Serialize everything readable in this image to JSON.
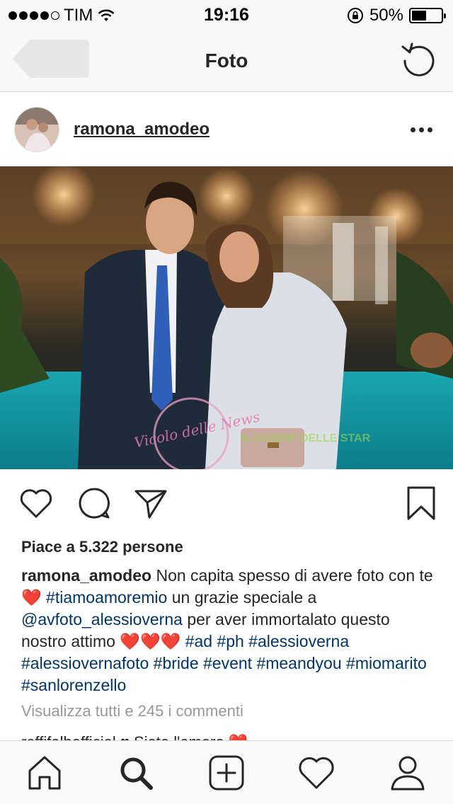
{
  "status_bar": {
    "carrier": "TIM",
    "time": "19:16",
    "battery_percent": "50%",
    "battery_level": 0.5,
    "signal_bars": 4,
    "icons": [
      "wifi-icon",
      "orientation-lock-icon",
      "battery-icon"
    ]
  },
  "nav": {
    "title": "Foto",
    "back_icon": "back-arrow-icon",
    "refresh_icon": "refresh-icon"
  },
  "post": {
    "username": "ramona_amodeo",
    "more_icon": "more-dots-icon",
    "photo_watermark_1": "Vicolo delle News",
    "photo_watermark_2": "IL GOSSIP DELLE STAR",
    "likes": "Piace a 5.322 persone",
    "caption": {
      "user": "ramona_amodeo",
      "t1": " Non capita spesso di avere foto con te ",
      "h1": "❤️",
      "tag1": "#tiamoamoremio",
      "t2": " un grazie speciale a ",
      "mention": "@avfoto_alessioverna",
      "t3": " per aver immortalato questo nostro attimo ",
      "h2": "❤️❤️❤️",
      "tags": "#ad #ph #alessioverna #alessiovernafoto #bride #event #meandyou #miomarito #sanlorenzello"
    },
    "view_comments": "Visualizza tutti e 245 i commenti",
    "comment_peek": "raffifalbofficial ♥ Siete l'amore ❤️"
  },
  "tab_bar": {
    "items": [
      "home-icon",
      "search-icon",
      "new-post-icon",
      "activity-heart-icon",
      "profile-icon"
    ]
  },
  "colors": {
    "link": "#003569",
    "heart": "#e0245e",
    "bar_bg": "#f8f8f8"
  }
}
